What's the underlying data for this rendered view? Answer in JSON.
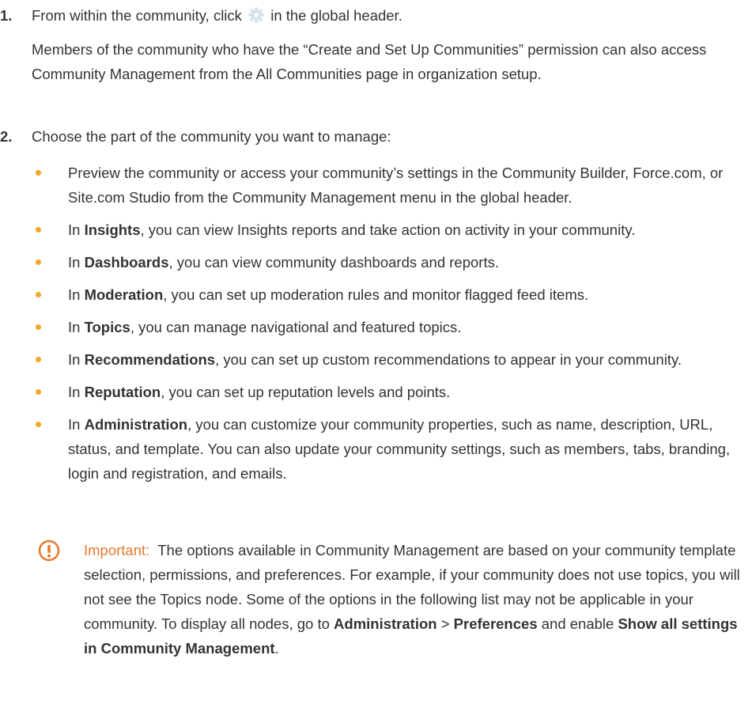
{
  "step1": {
    "number": "1.",
    "text_before_icon": "From within the community, click",
    "icon": "gear-icon",
    "text_after_icon": "in the global header.",
    "note": "Members of the community who have the “Create and Set Up Communities” permission can also access Community Management from the All Communities page in organization setup."
  },
  "step2": {
    "number": "2.",
    "intro": "Choose the part of the community you want to manage:",
    "bullets": [
      {
        "prefix": "",
        "bold": "",
        "text": "Preview the community or access your community’s settings in the Community Builder, Force.com, or Site.com Studio from the Community Management menu in the global header."
      },
      {
        "prefix": "In ",
        "bold": "Insights",
        "text": ", you can view Insights reports and take action on activity in your community."
      },
      {
        "prefix": "In ",
        "bold": "Dashboards",
        "text": ", you can view community dashboards and reports."
      },
      {
        "prefix": "In ",
        "bold": "Moderation",
        "text": ", you can set up moderation rules and monitor flagged feed items."
      },
      {
        "prefix": "In ",
        "bold": "Topics",
        "text": ", you can manage navigational and featured topics."
      },
      {
        "prefix": "In ",
        "bold": "Recommendations",
        "text": ", you can set up custom recommendations to appear in your community."
      },
      {
        "prefix": "In ",
        "bold": "Reputation",
        "text": ", you can set up reputation levels and points."
      },
      {
        "prefix": "In ",
        "bold": "Administration",
        "text": ", you can customize your community properties, such as name, description, URL, status, and template. You can also update your community settings, such as members, tabs, branding, login and registration, and emails."
      }
    ]
  },
  "important": {
    "icon": "important-icon",
    "label": "Important:",
    "text_1": "The options available in Community Management are based on your community template selection, permissions, and preferences. For example, if your community does not use topics, you will not see the Topics node. Some of the options in the following list may not be applicable in your community. To display all nodes, go to",
    "bold_1": "Administration",
    "sep": ">",
    "bold_2": "Preferences",
    "text_2": "and enable",
    "bold_3": "Show all settings in Community Management",
    "text_3": "."
  },
  "colors": {
    "text": "#333333",
    "bullet": "#f5a623",
    "important_accent": "#e8782c",
    "gear": "#cfe0ea"
  }
}
